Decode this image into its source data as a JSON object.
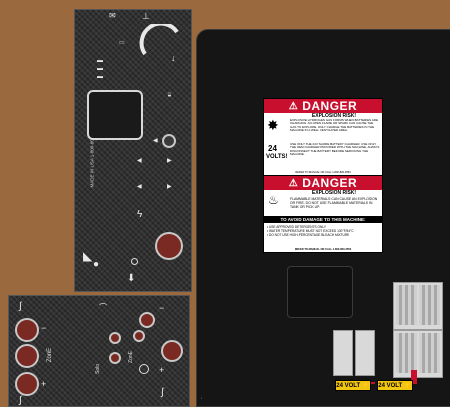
{
  "panel": {
    "vertical_label": "MADE IN USA 1-800-800-3553"
  },
  "danger1": {
    "header": "DANGER",
    "subtitle": "EXPLOSION RISK!",
    "body": "EXPLOSIVE HYDROGEN GAS FORMS WHEN BATTERIES ARE CHARGING. AN OPEN FLAME OR SPARK CAN CAUSE THE GAS TO EXPLODE. ONLY CHARGE THE BATTERIES IN THE MACHINE IN A WELL VENTILATED AREA.",
    "volts": "24",
    "volts_label": "VOLTS!",
    "body2": "USE ONLY THE 24V SHORE BATTERY CHARGER. USE ONLY THE OEM CHARGER PROVIDED WITH THE MACHINE. ALWAYS DISCONNECT THE BATTERY BEFORE SERVICING THE MACHINE.",
    "footer": "REFER TO MANUAL OR CALL 1-800-800-3553"
  },
  "danger2": {
    "header": "DANGER",
    "subtitle": "EXPLOSION RISK!",
    "body": "FLAMMABLE MATERIALS CAN CAUSE AN EXPLOSION OR FIRE. DO NOT USE FLAMMABLE MATERIALS IN TANK OR PICK UP.",
    "avoid_title": "TO AVOID DAMAGE TO THIS MACHINE:",
    "items": [
      "• USE APPROVED DETERGENTS ONLY",
      "• WATER TEMPERATURE MUST NOT EXCEED 130°F/54°C",
      "• DO NOT USE HIGH-PERCENTAGE BLEACH MIXTURE"
    ],
    "footer": "REFER TO MANUAL OR CALL 1-800-800-3553"
  },
  "volt_tags": {
    "left": "24 VOLT",
    "right": "24 VOLT"
  },
  "lower_panel": {
    "label_left": "ZonE",
    "label_mid": "Solo",
    "label_mid2": "ZonE"
  }
}
